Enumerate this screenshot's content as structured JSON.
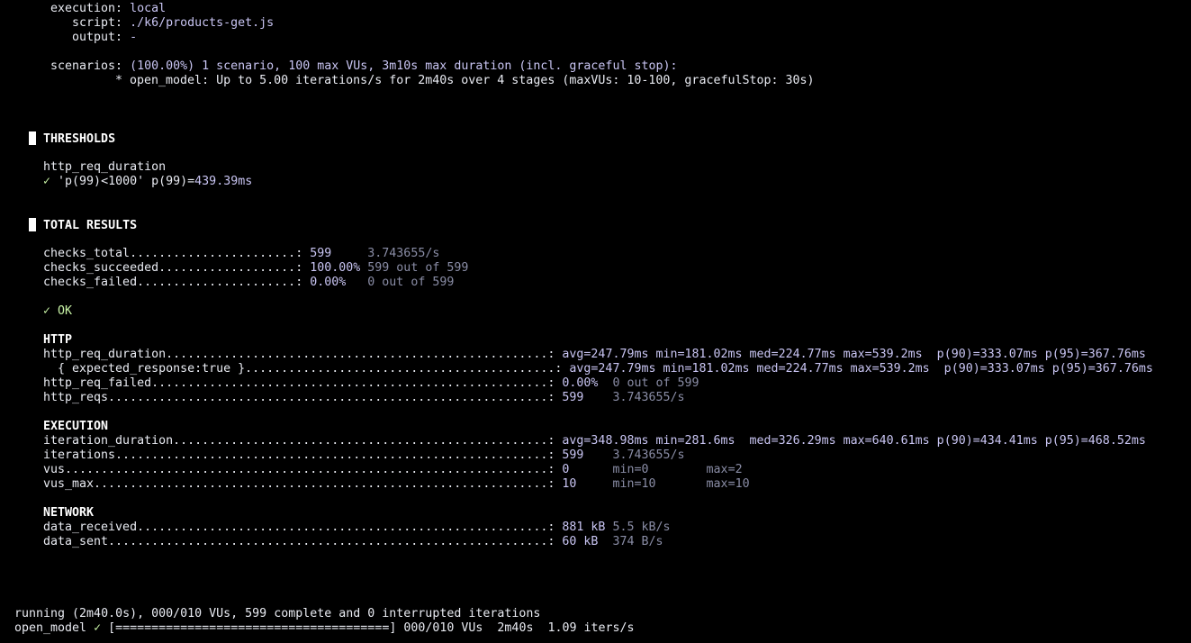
{
  "header": {
    "execution_key": "execution:",
    "execution_val": "local",
    "script_key": "script:",
    "script_val": "./k6/products-get.js",
    "output_key": "output:",
    "output_val": "-",
    "scenarios_key": "scenarios:",
    "scenarios_val": "(100.00%) 1 scenario, 100 max VUs, 3m10s max duration (incl. graceful stop):",
    "scenario_item": "* open_model: Up to 5.00 iterations/s for 2m40s over 4 stages (maxVUs: 10-100, gracefulStop: 30s)"
  },
  "thresholds": {
    "title": "THRESHOLDS",
    "metric": "http_req_duration",
    "check_mark": "✓",
    "rule": "'p(99)<1000'",
    "result_key": "p(99)=",
    "result_val": "439.39ms"
  },
  "total": {
    "title": "TOTAL RESULTS",
    "checks_total_key": "checks_total.......................:",
    "checks_total_val": "599",
    "checks_total_rate": "3.743655/s",
    "checks_succeeded_key": "checks_succeeded...................:",
    "checks_succeeded_val": "100.00%",
    "checks_succeeded_extra": "599 out of 599",
    "checks_failed_key": "checks_failed......................:",
    "checks_failed_val": "0.00%",
    "checks_failed_extra": "0 out of 599",
    "ok_mark": "✓",
    "ok_label": "OK"
  },
  "http": {
    "title": "HTTP",
    "req_duration_key": "http_req_duration.....................................................:",
    "req_duration_val": "avg=247.79ms min=181.02ms med=224.77ms max=539.2ms  p(90)=333.07ms p(95)=367.76ms",
    "expected_key": "  { expected_response:true }...........................................:",
    "expected_val": "avg=247.79ms min=181.02ms med=224.77ms max=539.2ms  p(90)=333.07ms p(95)=367.76ms",
    "req_failed_key": "http_req_failed.......................................................:",
    "req_failed_val": "0.00%",
    "req_failed_extra": "0 out of 599",
    "reqs_key": "http_reqs.............................................................:",
    "reqs_val": "599",
    "reqs_rate": "3.743655/s"
  },
  "execution": {
    "title": "EXECUTION",
    "iter_dur_key": "iteration_duration....................................................:",
    "iter_dur_val": "avg=348.98ms min=281.6ms  med=326.29ms max=640.61ms p(90)=434.41ms p(95)=468.52ms",
    "iterations_key": "iterations............................................................:",
    "iterations_val": "599",
    "iterations_rate": "3.743655/s",
    "vus_key": "vus...................................................................:",
    "vus_val": "0",
    "vus_min": "min=0",
    "vus_max": "max=2",
    "vusmax_key": "vus_max...............................................................:",
    "vusmax_val": "10",
    "vusmax_min": "min=10",
    "vusmax_max": "max=10"
  },
  "network": {
    "title": "NETWORK",
    "recv_key": "data_received.........................................................:",
    "recv_val": "881 kB",
    "recv_rate": "5.5 kB/s",
    "sent_key": "data_sent.............................................................:",
    "sent_val": "60 kB",
    "sent_rate": "374 B/s"
  },
  "footer": {
    "running": "running (2m40.0s), 000/010 VUs, 599 complete and 0 interrupted iterations",
    "scenario_name": "open_model",
    "check_mark": "✓",
    "progress_bar": "[======================================]",
    "vus": "000/010 VUs",
    "duration": "2m40s",
    "rate": "1.09 iters/s"
  }
}
